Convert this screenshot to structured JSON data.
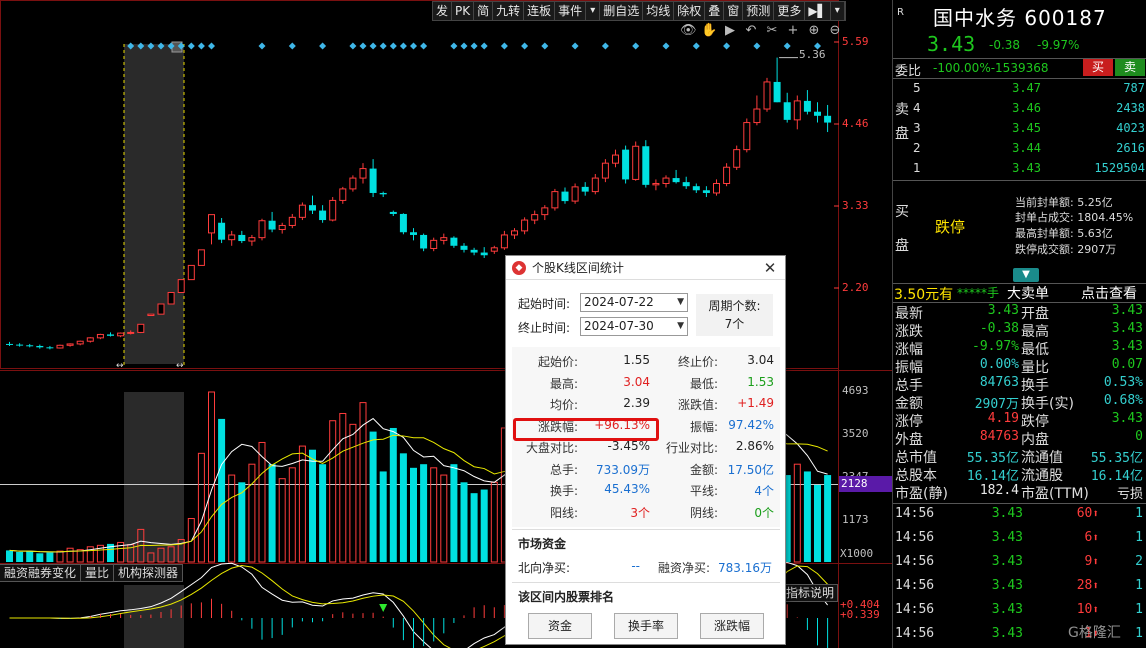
{
  "toolbar": [
    "发",
    "PK",
    "简",
    "九转",
    "连板",
    "事件",
    "▾",
    "删自选",
    "均线",
    "除权",
    "叠",
    "窗",
    "预测",
    "更多",
    "▶▌",
    "▾"
  ],
  "chart_icons": [
    "eye-icon",
    "hand-icon",
    "play-icon",
    "reset-icon",
    "scissors-icon",
    "plus-icon",
    "zoom-in-icon",
    "zoom-out-icon"
  ],
  "chart_icon_glyphs": [
    "👁",
    "✋",
    "▶",
    "↶",
    "✂",
    "+",
    "⊕",
    "⊖"
  ],
  "price_axis": {
    "labels": [
      "5.59",
      "4.46",
      "3.33",
      "2.20"
    ],
    "high_marker": "5.36"
  },
  "volume_axis": {
    "labels": [
      "4693",
      "3520",
      "2347",
      "1173"
    ],
    "current": "2128",
    "unit": "X1000"
  },
  "sub_tabs": [
    "融资融券变化",
    "量比",
    "机构探测器"
  ],
  "indicator_help": "指标说明",
  "indicator_values": [
    "+0.404",
    "+0.339"
  ],
  "colors": {
    "up": "#ff3c3c",
    "down": "#00e0e0",
    "green_text": "#1ec81e",
    "highlight": "#e01010",
    "limit_yellow": "#ffe400"
  },
  "chart_data": {
    "type": "candlestick",
    "price_range": [
      1.07,
      5.59
    ],
    "ohlc": [
      [
        1.13,
        1.16,
        1.1,
        1.12
      ],
      [
        1.12,
        1.14,
        1.09,
        1.11
      ],
      [
        1.11,
        1.13,
        1.08,
        1.1
      ],
      [
        1.1,
        1.12,
        1.06,
        1.08
      ],
      [
        1.08,
        1.1,
        1.05,
        1.07
      ],
      [
        1.07,
        1.12,
        1.06,
        1.11
      ],
      [
        1.11,
        1.14,
        1.09,
        1.13
      ],
      [
        1.13,
        1.18,
        1.11,
        1.17
      ],
      [
        1.17,
        1.23,
        1.15,
        1.22
      ],
      [
        1.22,
        1.28,
        1.2,
        1.27
      ],
      [
        1.27,
        1.3,
        1.24,
        1.25
      ],
      [
        1.25,
        1.3,
        1.23,
        1.29
      ],
      [
        1.29,
        1.33,
        1.27,
        1.3
      ],
      [
        1.3,
        1.42,
        1.29,
        1.42
      ],
      [
        1.55,
        1.57,
        1.55,
        1.57
      ],
      [
        1.57,
        1.72,
        1.57,
        1.72
      ],
      [
        1.72,
        1.89,
        1.72,
        1.89
      ],
      [
        1.89,
        2.08,
        1.89,
        2.08
      ],
      [
        2.08,
        2.29,
        2.08,
        2.29
      ],
      [
        2.29,
        2.52,
        2.29,
        2.52
      ],
      [
        2.77,
        3.04,
        2.6,
        3.04
      ],
      [
        2.92,
        2.99,
        2.62,
        2.67
      ],
      [
        2.67,
        2.8,
        2.58,
        2.74
      ],
      [
        2.74,
        2.8,
        2.62,
        2.65
      ],
      [
        2.65,
        2.74,
        2.58,
        2.7
      ],
      [
        2.7,
        2.98,
        2.66,
        2.95
      ],
      [
        2.95,
        3.08,
        2.78,
        2.82
      ],
      [
        2.82,
        2.92,
        2.76,
        2.88
      ],
      [
        2.88,
        3.05,
        2.84,
        3.0
      ],
      [
        3.0,
        3.22,
        2.96,
        3.18
      ],
      [
        3.18,
        3.32,
        3.05,
        3.1
      ],
      [
        3.1,
        3.18,
        2.92,
        2.96
      ],
      [
        2.96,
        3.3,
        2.94,
        3.25
      ],
      [
        3.25,
        3.45,
        3.2,
        3.42
      ],
      [
        3.42,
        3.62,
        3.38,
        3.58
      ],
      [
        3.58,
        3.8,
        3.5,
        3.72
      ],
      [
        3.72,
        3.86,
        3.3,
        3.36
      ],
      [
        3.36,
        3.38,
        3.3,
        3.34
      ],
      [
        3.08,
        3.1,
        3.02,
        3.05
      ],
      [
        3.05,
        3.06,
        2.75,
        2.78
      ],
      [
        2.78,
        2.84,
        2.66,
        2.74
      ],
      [
        2.74,
        2.76,
        2.5,
        2.54
      ],
      [
        2.54,
        2.7,
        2.5,
        2.66
      ],
      [
        2.66,
        2.76,
        2.6,
        2.7
      ],
      [
        2.7,
        2.72,
        2.55,
        2.58
      ],
      [
        2.58,
        2.62,
        2.48,
        2.52
      ],
      [
        2.52,
        2.55,
        2.44,
        2.48
      ],
      [
        2.48,
        2.56,
        2.4,
        2.44
      ],
      [
        2.5,
        2.58,
        2.46,
        2.55
      ],
      [
        2.55,
        2.8,
        2.52,
        2.74
      ],
      [
        2.74,
        2.84,
        2.68,
        2.8
      ],
      [
        2.8,
        3.0,
        2.75,
        2.96
      ],
      [
        2.96,
        3.1,
        2.9,
        3.04
      ],
      [
        3.04,
        3.18,
        2.96,
        3.14
      ],
      [
        3.14,
        3.42,
        3.1,
        3.38
      ],
      [
        3.38,
        3.44,
        3.2,
        3.24
      ],
      [
        3.24,
        3.5,
        3.2,
        3.45
      ],
      [
        3.45,
        3.52,
        3.32,
        3.38
      ],
      [
        3.38,
        3.64,
        3.34,
        3.58
      ],
      [
        3.58,
        3.86,
        3.52,
        3.8
      ],
      [
        3.8,
        4.0,
        3.74,
        3.92
      ],
      [
        4.0,
        4.06,
        3.5,
        3.56
      ],
      [
        3.56,
        4.12,
        3.54,
        4.05
      ],
      [
        4.05,
        4.14,
        3.44,
        3.48
      ],
      [
        3.48,
        3.56,
        3.4,
        3.5
      ],
      [
        3.5,
        3.62,
        3.44,
        3.58
      ],
      [
        3.58,
        3.7,
        3.5,
        3.52
      ],
      [
        3.52,
        3.6,
        3.42,
        3.46
      ],
      [
        3.46,
        3.5,
        3.36,
        3.4
      ],
      [
        3.4,
        3.46,
        3.3,
        3.36
      ],
      [
        3.36,
        3.56,
        3.32,
        3.5
      ],
      [
        3.5,
        3.8,
        3.46,
        3.74
      ],
      [
        3.74,
        4.06,
        3.7,
        4.0
      ],
      [
        4.0,
        4.46,
        3.96,
        4.4
      ],
      [
        4.4,
        4.8,
        4.36,
        4.6
      ],
      [
        4.6,
        5.06,
        4.56,
        5.0
      ],
      [
        5.0,
        5.36,
        4.7,
        4.7
      ],
      [
        4.7,
        4.84,
        4.4,
        4.44
      ],
      [
        4.44,
        4.8,
        4.3,
        4.72
      ],
      [
        4.72,
        4.88,
        4.52,
        4.56
      ],
      [
        4.56,
        4.7,
        4.4,
        4.5
      ],
      [
        4.5,
        4.66,
        4.26,
        4.4
      ]
    ],
    "volume": [
      320,
      280,
      300,
      240,
      260,
      300,
      380,
      340,
      420,
      460,
      500,
      540,
      480,
      900,
      250,
      380,
      420,
      620,
      1200,
      3000,
      4693,
      3950,
      2400,
      2200,
      2700,
      3300,
      2700,
      2300,
      2600,
      3200,
      3100,
      2700,
      3900,
      4100,
      3800,
      4400,
      3600,
      2500,
      3700,
      3000,
      2600,
      2700,
      2600,
      2400,
      2700,
      2200,
      1900,
      2000,
      2200,
      3700,
      3300,
      3600,
      3000,
      2900,
      4200,
      3500,
      3800,
      3200,
      3600,
      3800,
      4000,
      3300,
      4000,
      3300,
      2900,
      2800,
      3200,
      3000,
      2700,
      2600,
      2800,
      3600,
      3400,
      3900,
      4100,
      4300,
      2800,
      2400,
      2700,
      2500,
      2128,
      2400
    ]
  },
  "dialog": {
    "title": "个股K线区间统计",
    "start_label": "起始时间:",
    "start_value": "2024-07-22",
    "end_label": "终止时间:",
    "end_value": "2024-07-30",
    "period_label": "周期个数:",
    "period_value": "7个",
    "stats": [
      {
        "l1": "起始价:",
        "v1": "1.55",
        "c1": "black",
        "l2": "终止价:",
        "v2": "3.04",
        "c2": "black"
      },
      {
        "l1": "最高:",
        "v1": "3.04",
        "c1": "red",
        "l2": "最低:",
        "v2": "1.53",
        "c2": "green"
      },
      {
        "l1": "均价:",
        "v1": "2.39",
        "c1": "black",
        "l2": "涨跌值:",
        "v2": "+1.49",
        "c2": "red"
      },
      {
        "l1": "涨跌幅:",
        "v1": "+96.13%",
        "c1": "red",
        "l2": "振幅:",
        "v2": "97.42%",
        "c2": "blue"
      },
      {
        "l1": "大盘对比:",
        "v1": "-3.45%",
        "c1": "black",
        "l2": "行业对比:",
        "v2": "2.86%",
        "c2": "black"
      },
      {
        "l1": "总手:",
        "v1": "733.09万",
        "c1": "blue",
        "l2": "金额:",
        "v2": "17.50亿",
        "c2": "blue"
      },
      {
        "l1": "换手:",
        "v1": "45.43%",
        "c1": "blue",
        "l2": "平线:",
        "v2": "4个",
        "c2": "blue"
      },
      {
        "l1": "阳线:",
        "v1": "3个",
        "c1": "red",
        "l2": "阴线:",
        "v2": "0个",
        "c2": "green"
      }
    ],
    "market_funds_title": "市场资金",
    "north_label": "北向净买:",
    "north_value": "--",
    "margin_label": "融资净买:",
    "margin_value": "783.16万",
    "rank_title": "该区间内股票排名",
    "buttons": [
      "资金",
      "换手率",
      "涨跌幅"
    ]
  },
  "quote": {
    "r_badge": "R",
    "name": "国中水务",
    "code": "600187",
    "price": "3.43",
    "change": "-0.38",
    "pct": "-9.97%",
    "weibi_label": "委比",
    "weibi_value": "-100.00%-1539368",
    "buy_btn": "买",
    "sell_btn": "卖",
    "sell_side": [
      "卖",
      "盘"
    ],
    "buy_side": [
      "买",
      "盘"
    ],
    "asks": [
      {
        "lv": "5",
        "price": "3.47",
        "qty": "787"
      },
      {
        "lv": "4",
        "price": "3.46",
        "qty": "2438"
      },
      {
        "lv": "3",
        "price": "3.45",
        "qty": "4023"
      },
      {
        "lv": "2",
        "price": "3.44",
        "qty": "2616"
      },
      {
        "lv": "1",
        "price": "3.43",
        "qty": "1529504"
      }
    ],
    "limit_label": "跌停",
    "seal": [
      "当前封单额: 5.25亿",
      "封单占成交: 1804.45%",
      "最高封单额: 5.63亿",
      "跌停成交额: 2907万"
    ],
    "bigorder": {
      "a": "3.50元有",
      "b": "*****手",
      "c": "大卖单",
      "d": "点击查看"
    },
    "rows": [
      {
        "k": "最新",
        "v": "3.43",
        "vc": "green",
        "k2": "开盘",
        "v2": "3.43",
        "v2c": "green"
      },
      {
        "k": "涨跌",
        "v": "-0.38",
        "vc": "green",
        "k2": "最高",
        "v2": "3.43",
        "v2c": "green"
      },
      {
        "k": "涨幅",
        "v": "-9.97%",
        "vc": "green",
        "k2": "最低",
        "v2": "3.43",
        "v2c": "green"
      },
      {
        "k": "振幅",
        "v": "0.00%",
        "vc": "cyan",
        "k2": "量比",
        "v2": "0.07",
        "v2c": "green"
      },
      {
        "k": "总手",
        "v": "84763",
        "vc": "cyan",
        "k2": "换手",
        "v2": "0.53%",
        "v2c": "cyan"
      },
      {
        "k": "金额",
        "v": "2907万",
        "vc": "cyan",
        "k2": "换手(实)",
        "v2": "0.68%",
        "v2c": "cyan"
      },
      {
        "k": "涨停",
        "v": "4.19",
        "vc": "red",
        "k2": "跌停",
        "v2": "3.43",
        "v2c": "green"
      },
      {
        "k": "外盘",
        "v": "84763",
        "vc": "red",
        "k2": "内盘",
        "v2": "0",
        "v2c": "green"
      },
      {
        "k": "总市值",
        "v": "55.35亿",
        "vc": "cyan",
        "k2": "流通值",
        "v2": "55.35亿",
        "v2c": "cyan"
      },
      {
        "k": "总股本",
        "v": "16.14亿",
        "vc": "cyan",
        "k2": "流通股",
        "v2": "16.14亿",
        "v2c": "cyan"
      },
      {
        "k": "市盈(静)",
        "v": "182.4",
        "vc": "white",
        "k2": "市盈(TTM)",
        "v2": "亏损",
        "v2c": "white"
      }
    ],
    "ticks": [
      {
        "t": "14:56",
        "p": "3.43",
        "q": "60",
        "n": "1"
      },
      {
        "t": "14:56",
        "p": "3.43",
        "q": "6",
        "n": "1"
      },
      {
        "t": "14:56",
        "p": "3.43",
        "q": "9",
        "n": "2"
      },
      {
        "t": "14:56",
        "p": "3.43",
        "q": "28",
        "n": "1"
      },
      {
        "t": "14:56",
        "p": "3.43",
        "q": "10",
        "n": "1"
      },
      {
        "t": "14:56",
        "p": "3.43",
        "q": "1",
        "n": "1"
      }
    ]
  },
  "watermark": "G格隆汇"
}
